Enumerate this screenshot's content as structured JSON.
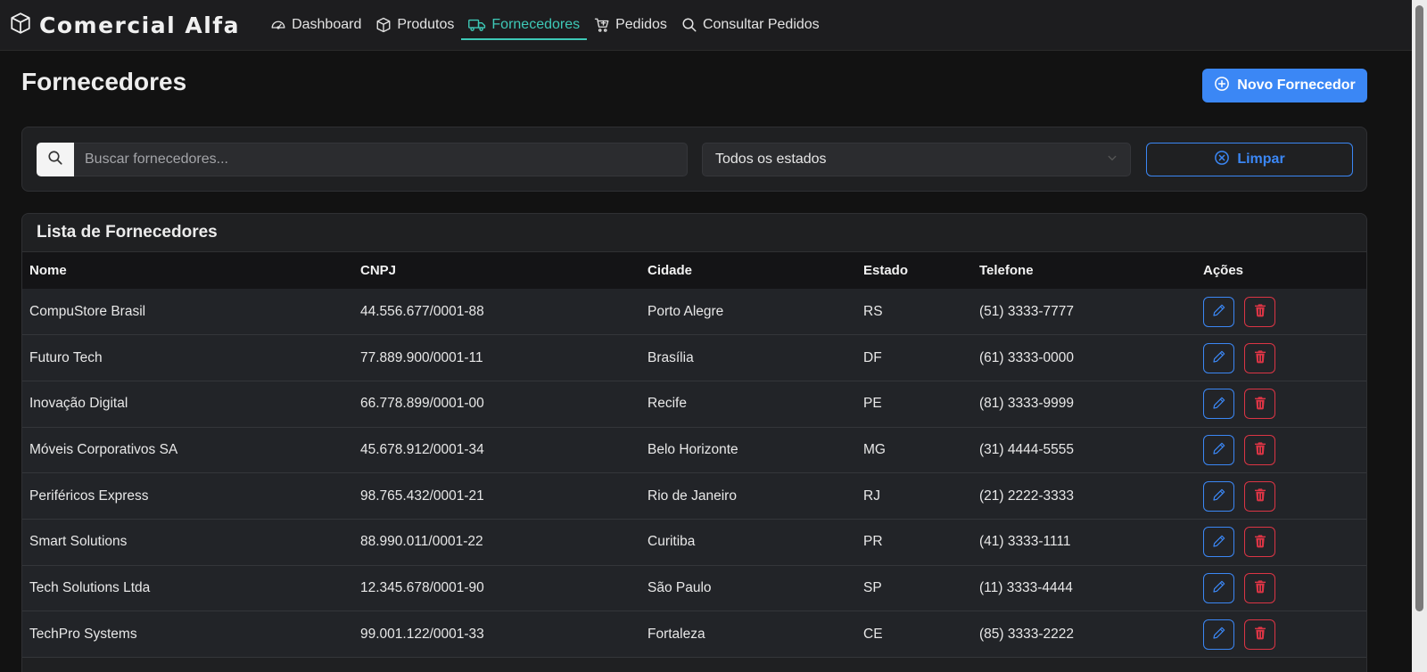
{
  "brand": {
    "title": "Comercial Alfa",
    "icon": "box-icon"
  },
  "nav": [
    {
      "label": "Dashboard",
      "icon": "speedometer-icon",
      "active": false
    },
    {
      "label": "Produtos",
      "icon": "box-icon",
      "active": false
    },
    {
      "label": "Fornecedores",
      "icon": "truck-icon",
      "active": true
    },
    {
      "label": "Pedidos",
      "icon": "cart-icon",
      "active": false
    },
    {
      "label": "Consultar Pedidos",
      "icon": "search-icon",
      "active": false
    }
  ],
  "page": {
    "title": "Fornecedores",
    "new_button": "Novo Fornecedor"
  },
  "filters": {
    "search_placeholder": "Buscar fornecedores...",
    "search_value": "",
    "state_selected": "Todos os estados",
    "clear_button": "Limpar"
  },
  "table": {
    "title": "Lista de Fornecedores",
    "columns": [
      "Nome",
      "CNPJ",
      "Cidade",
      "Estado",
      "Telefone",
      "Ações"
    ],
    "rows": [
      [
        "CompuStore Brasil",
        "44.556.677/0001-88",
        "Porto Alegre",
        "RS",
        "(51) 3333-7777"
      ],
      [
        "Futuro Tech",
        "77.889.900/0001-11",
        "Brasília",
        "DF",
        "(61) 3333-0000"
      ],
      [
        "Inovação Digital",
        "66.778.899/0001-00",
        "Recife",
        "PE",
        "(81) 3333-9999"
      ],
      [
        "Móveis Corporativos SA",
        "45.678.912/0001-34",
        "Belo Horizonte",
        "MG",
        "(31) 4444-5555"
      ],
      [
        "Periféricos Express",
        "98.765.432/0001-21",
        "Rio de Janeiro",
        "RJ",
        "(21) 2222-3333"
      ],
      [
        "Smart Solutions",
        "88.990.011/0001-22",
        "Curitiba",
        "PR",
        "(41) 3333-1111"
      ],
      [
        "Tech Solutions Ltda",
        "12.345.678/0001-90",
        "São Paulo",
        "SP",
        "(11) 3333-4444"
      ],
      [
        "TechPro Systems",
        "99.001.122/0001-33",
        "Fortaleza",
        "CE",
        "(85) 3333-2222"
      ]
    ]
  },
  "colors": {
    "accent": "#3ec9b7",
    "primary": "#3b87f5",
    "danger": "#dc3545",
    "background": "#121212"
  }
}
